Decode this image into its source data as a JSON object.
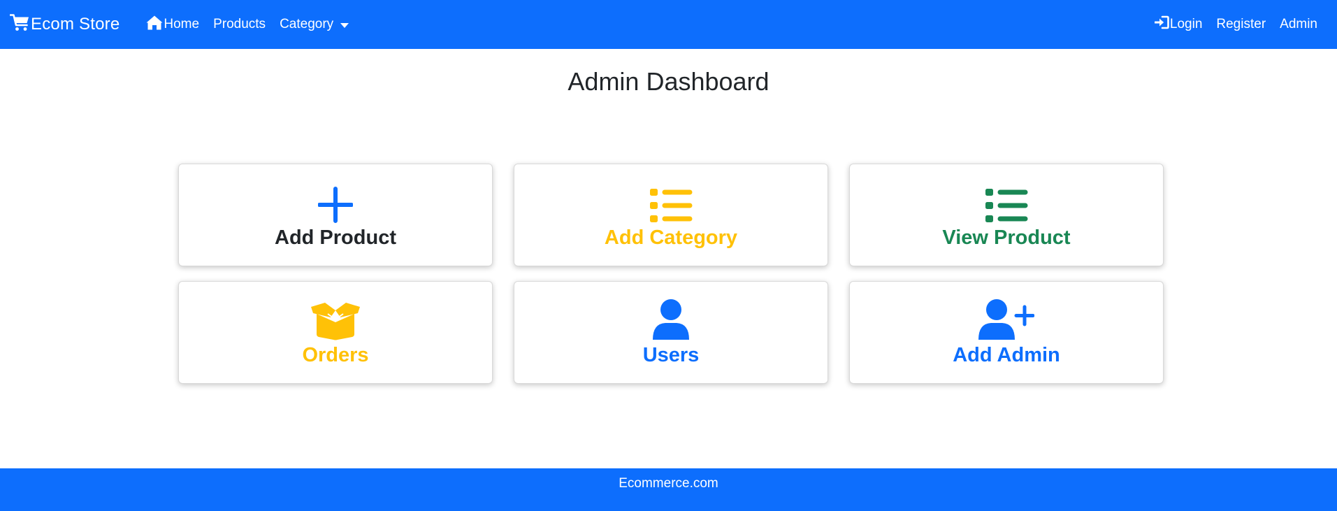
{
  "navbar": {
    "brand": "Ecom Store",
    "links_left": [
      "Home",
      "Products",
      "Category"
    ],
    "links_right": [
      "Login",
      "Register",
      "Admin"
    ],
    "background": "#0d6efd"
  },
  "page": {
    "title": "Admin Dashboard"
  },
  "cards": [
    {
      "label": "Add Product",
      "icon": "plus-icon",
      "color": "#212529",
      "icon_color": "#0d6efd"
    },
    {
      "label": "Add Category",
      "icon": "list-icon",
      "color": "#ffc107",
      "icon_color": "#ffc107"
    },
    {
      "label": "View Product",
      "icon": "list-icon",
      "color": "#198754",
      "icon_color": "#198754"
    },
    {
      "label": "Orders",
      "icon": "box-open-icon",
      "color": "#ffc107",
      "icon_color": "#ffc107"
    },
    {
      "label": "Users",
      "icon": "user-icon",
      "color": "#0d6efd",
      "icon_color": "#0d6efd"
    },
    {
      "label": "Add Admin",
      "icon": "user-plus-icon",
      "color": "#0d6efd",
      "icon_color": "#0d6efd"
    }
  ],
  "footer": {
    "text": "Ecommerce.com"
  }
}
